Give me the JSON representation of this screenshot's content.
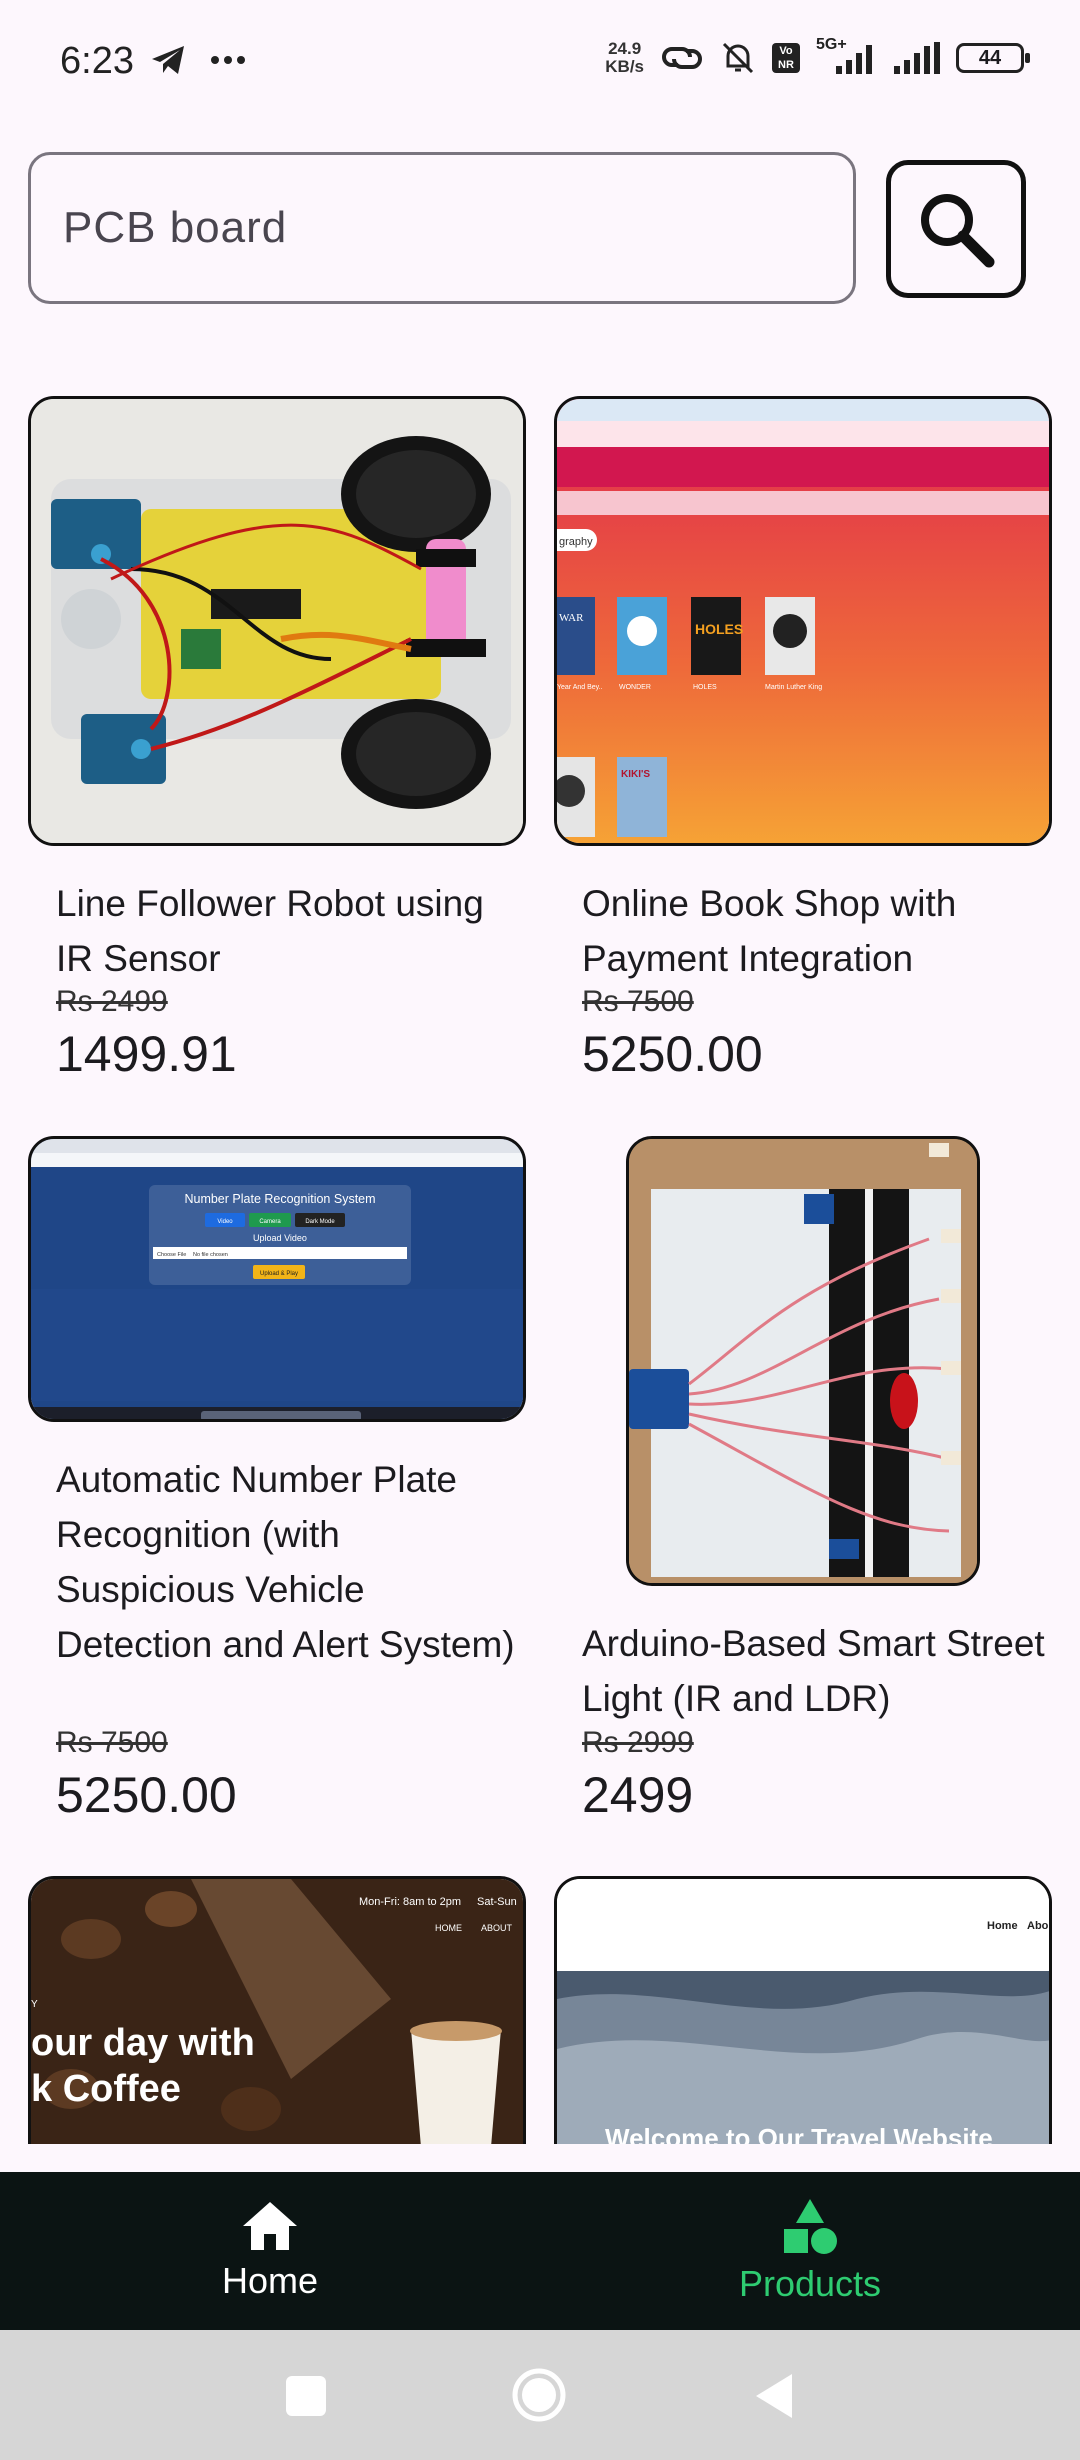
{
  "status": {
    "time": "6:23",
    "speed_value": "24.9",
    "speed_unit": "KB/s",
    "network": "5G+",
    "battery": "44",
    "volte_top": "Vo",
    "volte_bottom": "NR"
  },
  "search": {
    "value": "PCB board",
    "placeholder": "Search"
  },
  "products": [
    {
      "title": "Line Follower Robot using IR Sensor",
      "old_price": "Rs 2499",
      "price": "1499.91"
    },
    {
      "title": "Online Book Shop with Payment Integration",
      "old_price": "Rs 7500",
      "price": "5250.00"
    },
    {
      "title": "Automatic Number Plate Recognition (with Suspicious Vehicle Detection and Alert System)",
      "old_price": "Rs 7500",
      "price": "5250.00"
    },
    {
      "title": "Arduino-Based Smart Street Light (IR and LDR)",
      "old_price": "Rs 2999",
      "price": "2499"
    }
  ],
  "thumbs": {
    "books": {
      "chip": "graphy",
      "labels": [
        "Year And Bey..",
        "WONDER",
        "HOLES",
        "Martin Luther King"
      ],
      "covers": [
        "WAR",
        "",
        "HOLES",
        ""
      ],
      "last_cover": "KIKI'S"
    },
    "anpr": {
      "heading": "Number Plate Recognition System",
      "buttons": [
        "Video",
        "Camera",
        "Dark Mode"
      ],
      "sub": "Upload Video",
      "file_btn": "Choose File",
      "file_text": "No file chosen",
      "action": "Upload & Play"
    },
    "coffee": {
      "hours": "Mon-Fri: 8am to 2pm",
      "hours2": "Sat-Sun",
      "nav": [
        "HOME",
        "ABOUT"
      ],
      "line1": "our day with",
      "line2": "k Coffee",
      "tiny": "Y"
    },
    "travel": {
      "nav": [
        "Home",
        "Abo"
      ],
      "headline": "Welcome to Our Travel Website"
    }
  },
  "nav": {
    "home": "Home",
    "products": "Products",
    "active_color": "#2ecc71",
    "bg_color": "#0b1413"
  }
}
